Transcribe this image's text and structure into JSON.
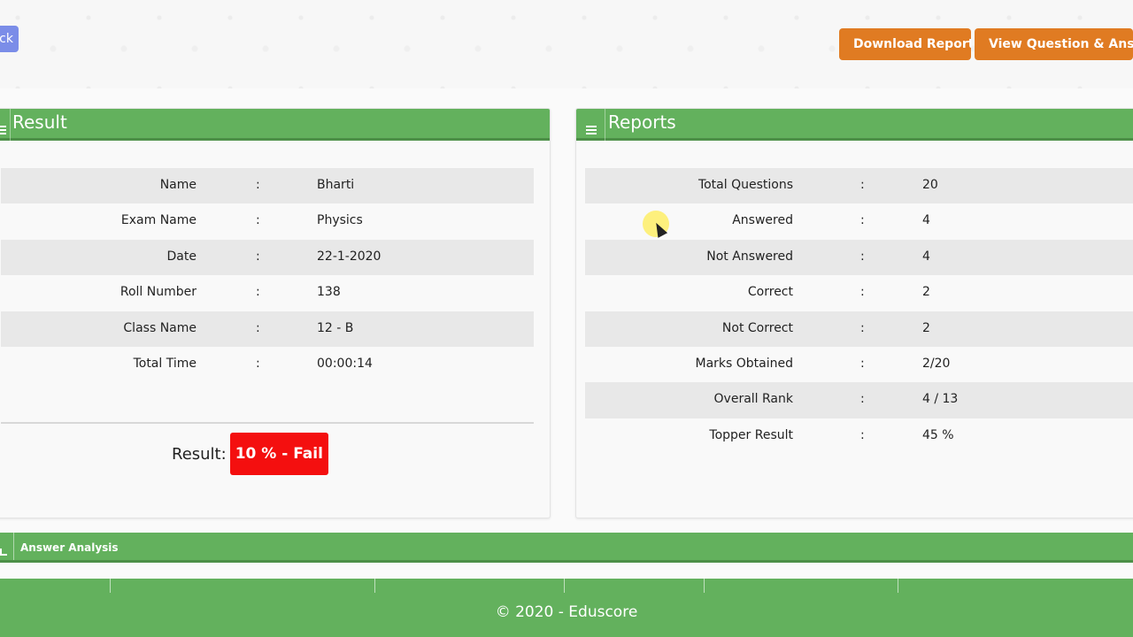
{
  "header": {
    "back_label": "Back",
    "download_label": "Download Report",
    "view_label": "View Question & Answer"
  },
  "result_panel": {
    "title": "Result",
    "rows": [
      {
        "label": "Name",
        "sep": ":",
        "value": "Bharti"
      },
      {
        "label": "Exam Name",
        "sep": ":",
        "value": "Physics"
      },
      {
        "label": "Date",
        "sep": ":",
        "value": "22-1-2020"
      },
      {
        "label": "Roll Number",
        "sep": ":",
        "value": "138"
      },
      {
        "label": "Class Name",
        "sep": ":",
        "value": "12 - B"
      },
      {
        "label": "Total Time",
        "sep": ":",
        "value": "00:00:14"
      }
    ],
    "result_label": "Result:",
    "result_value": "10 % - Fail",
    "result_color": "#f40f0f"
  },
  "reports_panel": {
    "title": "Reports",
    "icon": "hamburger-icon",
    "rows": [
      {
        "label": "Total Questions",
        "sep": ":",
        "value": "20"
      },
      {
        "label": "Answered",
        "sep": ":",
        "value": "4"
      },
      {
        "label": "Not Answered",
        "sep": ":",
        "value": "4"
      },
      {
        "label": "Correct",
        "sep": ":",
        "value": "2"
      },
      {
        "label": "Not Correct",
        "sep": ":",
        "value": "2"
      },
      {
        "label": "Marks Obtained",
        "sep": ":",
        "value": "2/20"
      },
      {
        "label": "Overall Rank",
        "sep": ":",
        "value": "4 / 13"
      },
      {
        "label": "Topper Result",
        "sep": ":",
        "value": "45 %"
      }
    ]
  },
  "analysis": {
    "title": "Answer Analysis",
    "icon": "chart-icon"
  },
  "footer": {
    "text": "© 2020 - Eduscore"
  },
  "colors": {
    "accent_green": "#63b15d",
    "button_orange": "#e07b22",
    "back_blue": "#7b8de8"
  }
}
